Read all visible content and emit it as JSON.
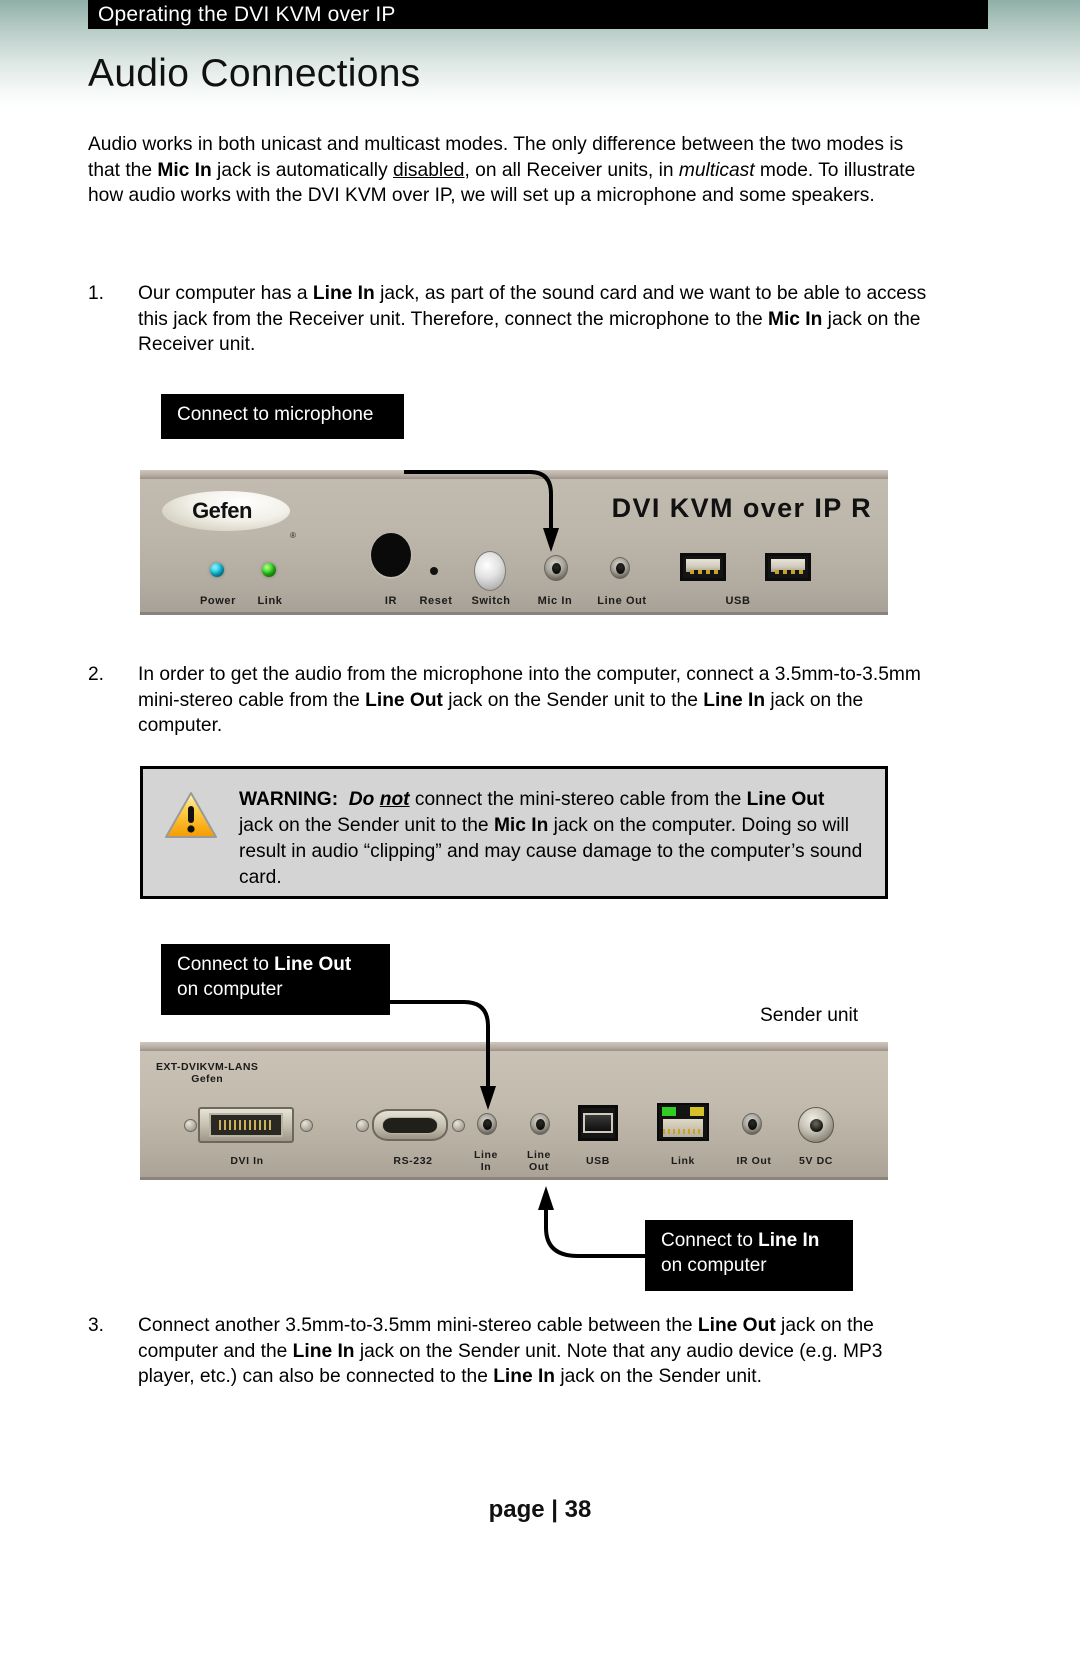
{
  "header": {
    "running_head": "Operating the DVI KVM over IP",
    "page_title": "Audio Connections"
  },
  "intro": {
    "p1_a": "Audio works in both unicast and multicast modes.  The only difference between the two modes is that the ",
    "p1_b": "Mic In",
    "p1_c": " jack is automatically ",
    "p1_d": "disabled",
    "p1_e": ", on all Receiver units, in ",
    "p1_f": "multicast",
    "p1_g": " mode.  To illustrate how audio works with the DVI KVM over IP, we will set up a microphone and some speakers."
  },
  "steps": [
    {
      "num": "1.",
      "a": "Our computer has a ",
      "b1": "Line In",
      "c": " jack, as part of the sound card and we want to be able to access this jack from the Receiver unit.  Therefore, connect the microphone to the ",
      "b2": "Mic In",
      "d": " jack on the Receiver unit."
    },
    {
      "num": "2.",
      "a": "In order to get the audio from the microphone into the computer, connect a 3.5mm-to-3.5mm mini-stereo cable from the ",
      "b1": "Line Out",
      "c": " jack on the Sender unit to the ",
      "b2": "Line In",
      "d": " jack on the computer."
    },
    {
      "num": "3.",
      "a": "Connect another 3.5mm-to-3.5mm mini-stereo cable between the ",
      "b1": "Line Out",
      "c": " jack on the computer and the ",
      "b2": "Line In",
      "d": " jack on the Sender unit.  Note that any audio device (e.g. MP3 player, etc.) can also be connected to the ",
      "b3": "Line In",
      "e": " jack on the Sender unit."
    }
  ],
  "callouts": {
    "mic": {
      "line1": "Connect to microphone"
    },
    "line_out": {
      "a": "Connect to ",
      "b": "Line Out",
      "line2": "on computer"
    },
    "line_in": {
      "a": "Connect to ",
      "b": "Line In",
      "line2": "on computer"
    }
  },
  "warning": {
    "label": "WARNING:",
    "do": "Do ",
    "not": "not",
    "t1": " connect the mini-stereo cable from the ",
    "b1": "Line Out",
    "t2": " jack on the Sender unit to the ",
    "b2": "Mic In",
    "t3": " jack on the computer.  Doing so will result in audio “clipping” and may cause damage to the computer’s sound card."
  },
  "receiver": {
    "brand": "Gefen",
    "registered": "®",
    "model_right": "DVI KVM over IP R",
    "labels": [
      "Power",
      "Link",
      "IR",
      "Reset",
      "Switch",
      "Mic In",
      "Line Out",
      "USB"
    ]
  },
  "sender": {
    "model_line1": "EXT-DVIKVM-LANS",
    "model_line2": "Gefen",
    "unit_caption": "Sender unit",
    "labels": [
      "DVI In",
      "RS-232",
      "Line\nIn",
      "Line\nOut",
      "USB",
      "Link",
      "IR Out",
      "5V DC"
    ]
  },
  "footer": {
    "text": "page | 38"
  },
  "colors": {
    "header_green": "#8fb0a7",
    "callout_bg": "#000000",
    "warning_bg": "#d4d4d4",
    "led_cyan": "#18c6e0",
    "led_green": "#2ed41c"
  }
}
